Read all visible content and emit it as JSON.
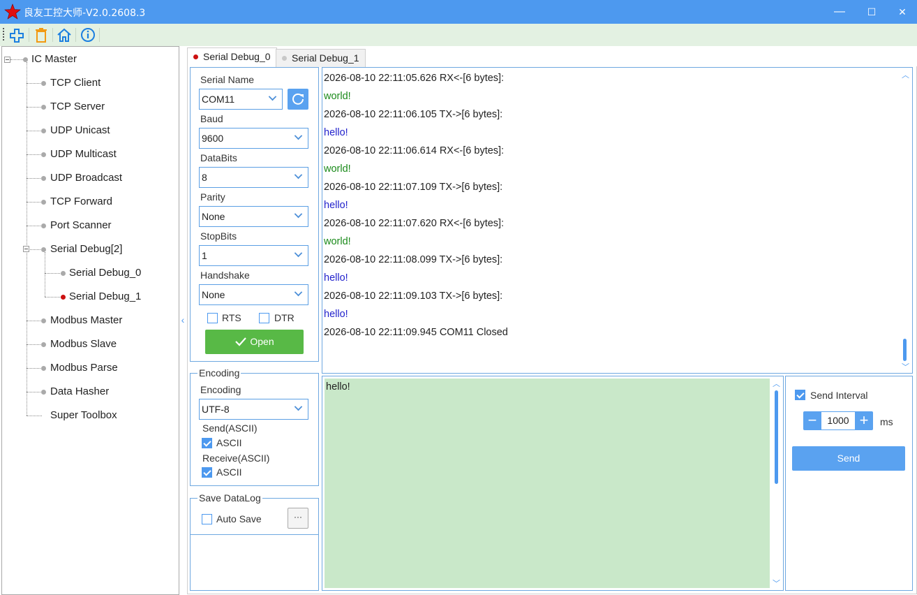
{
  "window": {
    "title": "良友工控大师-V2.0.2608.3",
    "minimize": "—",
    "maximize": "☐",
    "close": "✕"
  },
  "toolbar": {
    "icons": [
      "add-icon",
      "delete-icon",
      "home-icon",
      "info-icon"
    ]
  },
  "tree": {
    "root": "IC Master",
    "items": [
      "TCP Client",
      "TCP Server",
      "UDP Unicast",
      "UDP Multicast",
      "UDP Broadcast",
      "TCP Forward",
      "Port Scanner",
      "Serial Debug[2]"
    ],
    "serial_children": [
      "Serial Debug_0",
      "Serial Debug_1"
    ],
    "items_after": [
      "Modbus Master",
      "Modbus Slave",
      "Modbus Parse",
      "Data Hasher",
      "Super Toolbox"
    ],
    "collapse_glyph": "‹"
  },
  "tabs": [
    {
      "label": "Serial Debug_0",
      "dot_color": "#cc1111"
    },
    {
      "label": "Serial Debug_1",
      "dot_color": "#c8c8c8"
    }
  ],
  "settings": {
    "serial_name_label": "Serial Name",
    "serial_name_value": "COM11",
    "baud_label": "Baud",
    "baud_value": "9600",
    "databits_label": "DataBits",
    "databits_value": "8",
    "parity_label": "Parity",
    "parity_value": "None",
    "stopbits_label": "StopBits",
    "stopbits_value": "1",
    "handshake_label": "Handshake",
    "handshake_value": "None",
    "rts_label": "RTS",
    "dtr_label": "DTR",
    "open_label": "Open"
  },
  "encoding": {
    "group_title": "Encoding",
    "label": "Encoding",
    "value": "UTF-8",
    "send_label": "Send(ASCII)",
    "send_check": "ASCII",
    "receive_label": "Receive(ASCII)",
    "receive_check": "ASCII"
  },
  "savelog": {
    "group_title": "Save DataLog",
    "auto_save": "Auto Save",
    "browse": "···"
  },
  "log": [
    {
      "text": "2026-08-10 22:11:05.626 RX<-[6 bytes]:",
      "color": "#222222"
    },
    {
      "text": "world!",
      "color": "#1a8a1a"
    },
    {
      "text": "2026-08-10 22:11:06.105 TX->[6 bytes]:",
      "color": "#222222"
    },
    {
      "text": "hello!",
      "color": "#2222cc"
    },
    {
      "text": "2026-08-10 22:11:06.614 RX<-[6 bytes]:",
      "color": "#222222"
    },
    {
      "text": "world!",
      "color": "#1a8a1a"
    },
    {
      "text": "2026-08-10 22:11:07.109 TX->[6 bytes]:",
      "color": "#222222"
    },
    {
      "text": "hello!",
      "color": "#2222cc"
    },
    {
      "text": "2026-08-10 22:11:07.620 RX<-[6 bytes]:",
      "color": "#222222"
    },
    {
      "text": "world!",
      "color": "#1a8a1a"
    },
    {
      "text": "2026-08-10 22:11:08.099 TX->[6 bytes]:",
      "color": "#222222"
    },
    {
      "text": "hello!",
      "color": "#2222cc"
    },
    {
      "text": "2026-08-10 22:11:09.103 TX->[6 bytes]:",
      "color": "#222222"
    },
    {
      "text": "hello!",
      "color": "#2222cc"
    },
    {
      "text": "2026-08-10 22:11:09.945 COM11 Closed",
      "color": "#222222"
    }
  ],
  "send": {
    "text": "hello!",
    "interval_label": "Send Interval",
    "interval_value": "1000",
    "unit": "ms",
    "send_label": "Send",
    "minus": "−",
    "plus": "+"
  }
}
